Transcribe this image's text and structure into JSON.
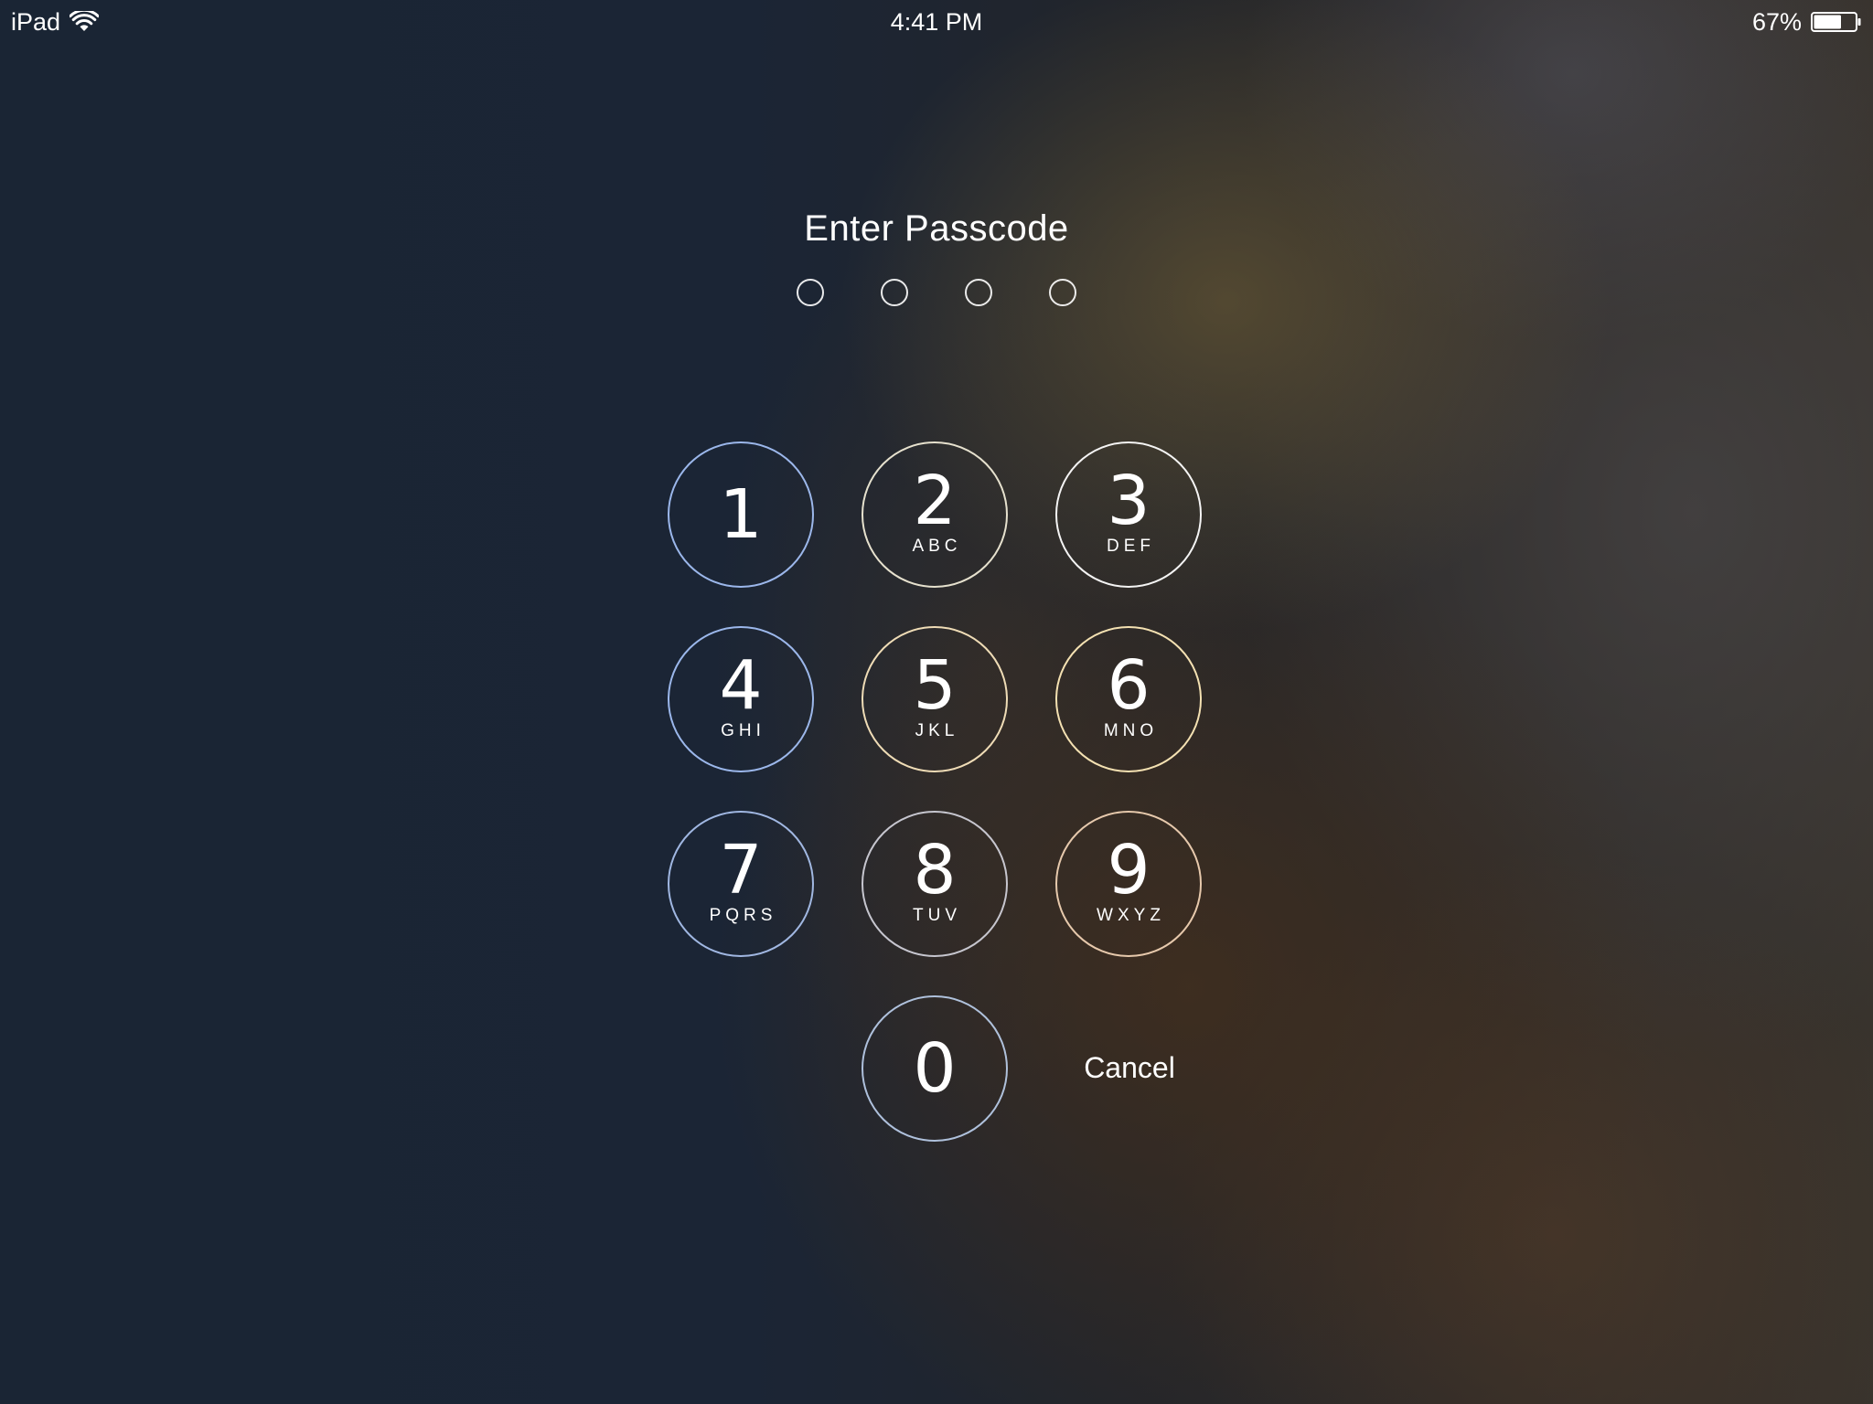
{
  "status_bar": {
    "device": "iPad",
    "wifi_icon": "wifi-icon",
    "time": "4:41 PM",
    "battery_percent": "67%",
    "battery_level": 0.67,
    "battery_icon": "battery-icon"
  },
  "title": "Enter Passcode",
  "passcode": {
    "length": 4,
    "entered": 0
  },
  "keypad": {
    "keys": [
      {
        "digit": "1",
        "letters": ""
      },
      {
        "digit": "2",
        "letters": "ABC"
      },
      {
        "digit": "3",
        "letters": "DEF"
      },
      {
        "digit": "4",
        "letters": "GHI"
      },
      {
        "digit": "5",
        "letters": "JKL"
      },
      {
        "digit": "6",
        "letters": "MNO"
      },
      {
        "digit": "7",
        "letters": "PQRS"
      },
      {
        "digit": "8",
        "letters": "TUV"
      },
      {
        "digit": "9",
        "letters": "WXYZ"
      },
      {
        "digit": "0",
        "letters": ""
      }
    ],
    "cancel_label": "Cancel"
  }
}
